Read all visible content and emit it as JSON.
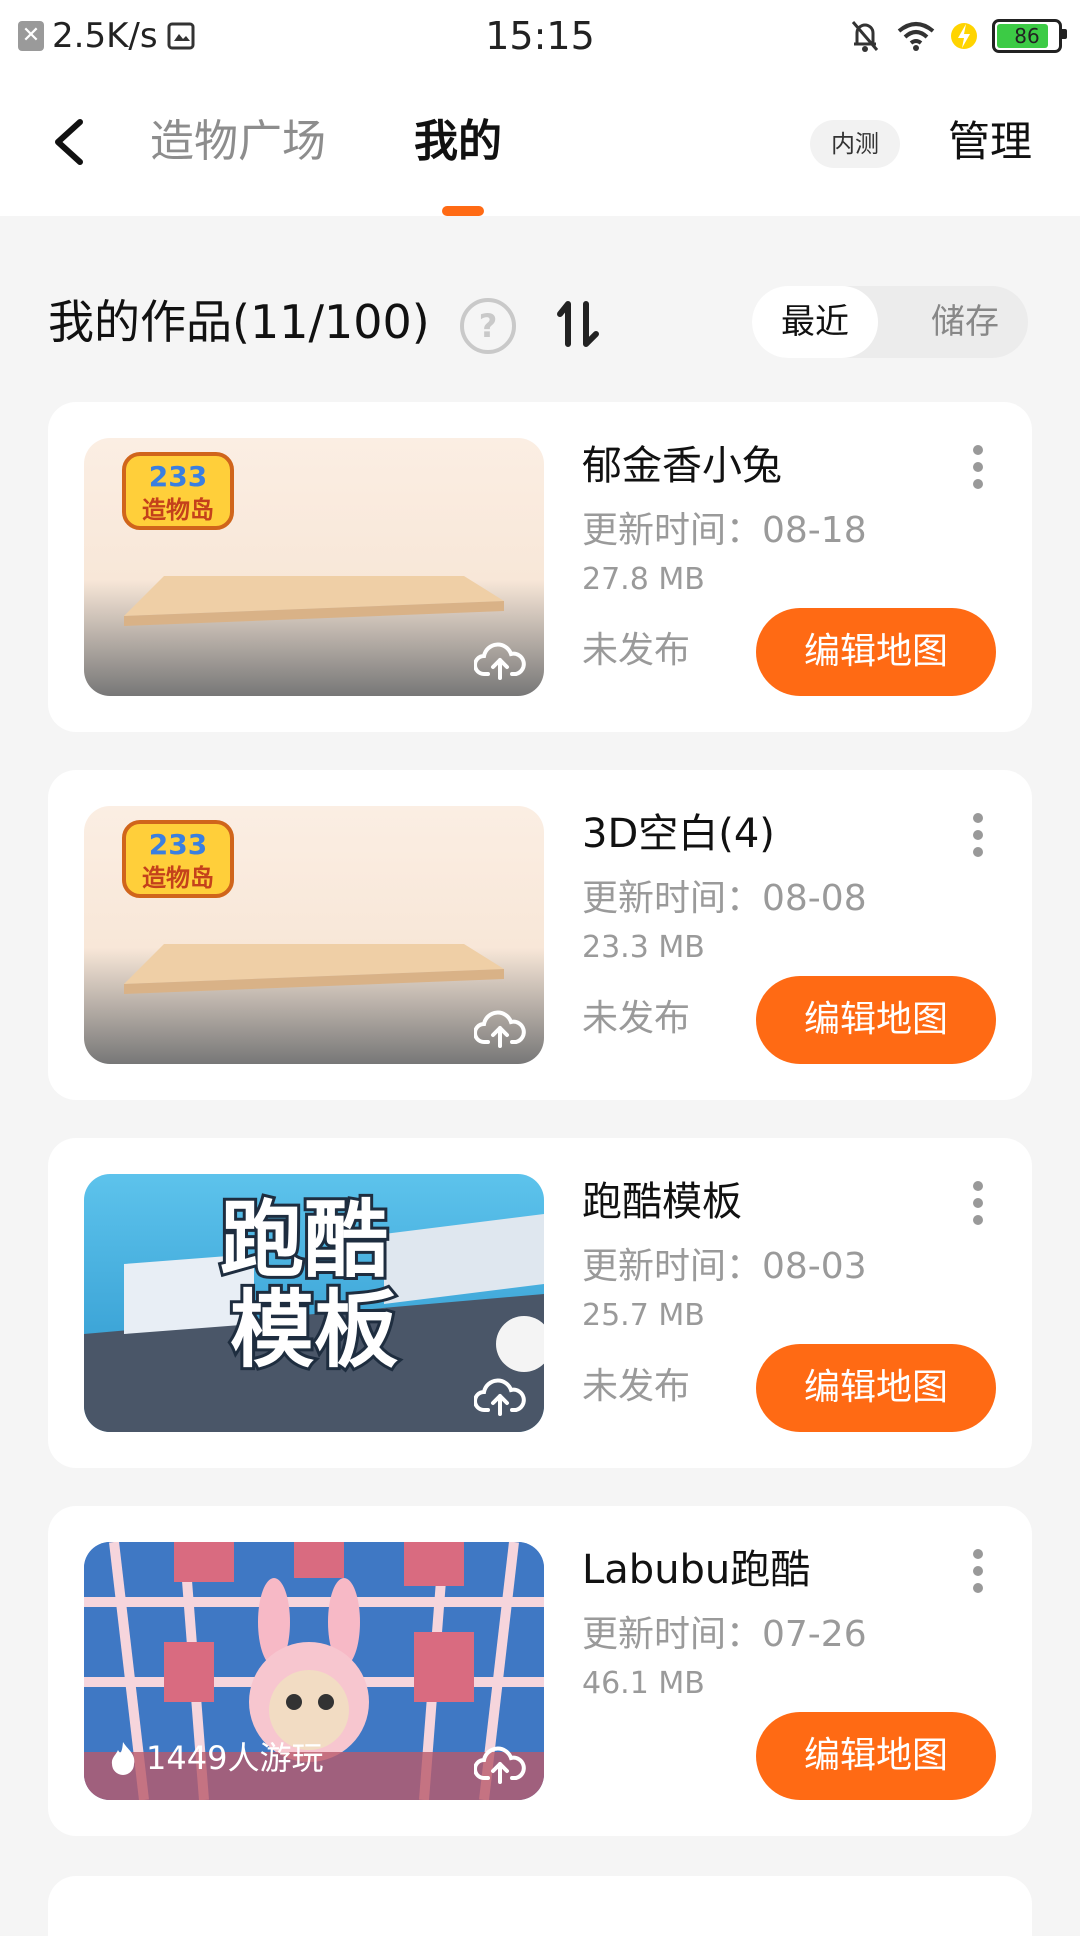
{
  "status_bar": {
    "net_speed": "2.5K/s",
    "time": "15:15",
    "battery": "86",
    "battery_level": 0.86
  },
  "header": {
    "tabs": [
      {
        "label": "造物广场",
        "active": false
      },
      {
        "label": "我的",
        "active": true
      }
    ],
    "badge": "内测",
    "manage": "管理"
  },
  "section": {
    "title": "我的作品(11/100)",
    "segments": [
      "最近",
      "储存"
    ],
    "active_segment": "最近"
  },
  "cards": [
    {
      "title": "郁金香小兔",
      "updated": "更新时间：08-18",
      "size": "27.8 MB",
      "status": "未发布",
      "action": "编辑地图",
      "thumb": "blank"
    },
    {
      "title": "3D空白(4)",
      "updated": "更新时间：08-08",
      "size": "23.3 MB",
      "status": "未发布",
      "action": "编辑地图",
      "thumb": "blank"
    },
    {
      "title": "跑酷模板",
      "updated": "更新时间：08-03",
      "size": "25.7 MB",
      "status": "未发布",
      "action": "编辑地图",
      "thumb": "parkour",
      "thumb_text": "跑酷\n模板"
    },
    {
      "title": "Labubu跑酷",
      "updated": "更新时间：07-26",
      "size": "46.1 MB",
      "status": "",
      "action": "编辑地图",
      "thumb": "labubu",
      "play_count": "1449人游玩"
    }
  ],
  "colors": {
    "accent": "#ff6a14",
    "muted": "#9a9a9a",
    "background": "#f5f5f5"
  },
  "logo_text": "233 造物岛"
}
